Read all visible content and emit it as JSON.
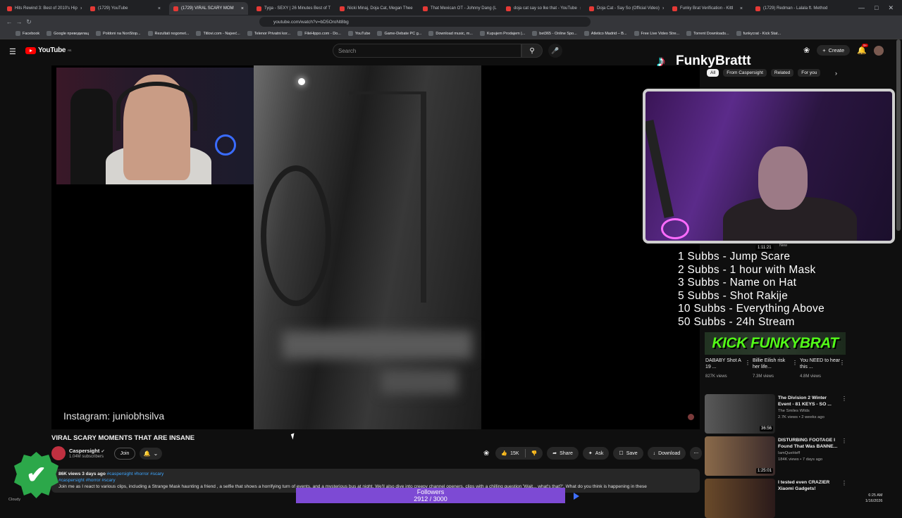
{
  "tabs": [
    {
      "label": "Hits Rewind 3: Best of 2010's Hip",
      "active": false
    },
    {
      "label": "(1729) YouTube",
      "active": false
    },
    {
      "label": "(1729) VIRAL SCARY MOM",
      "active": true
    },
    {
      "label": "Tyga - SEXY | 26 Minutes Best of T",
      "active": false
    },
    {
      "label": "Nicki Minaj, Doja Cat, Megan Thee",
      "active": false
    },
    {
      "label": "That Mexican OT - Johnny Dang (L",
      "active": false
    },
    {
      "label": "doja cat say so lke that - YouTube",
      "active": false
    },
    {
      "label": "Doja Cat - Say So (Official Video)",
      "active": false
    },
    {
      "label": "Funky Brat Verification - Kittl",
      "active": false
    },
    {
      "label": "(1729) Redman - Lalala ft. Method",
      "active": false
    }
  ],
  "url": "youtube.com/watch?v=bD5OroNt8bg",
  "bookmarks": [
    "Facebook",
    "Google преводилац",
    "Poldoni na NonStop...",
    "Rezultati nogomet...",
    "Titlovi.com - Najveć...",
    "Telenor Privatni kor...",
    "FileHippo.com - Do...",
    "YouTube",
    "Game-Debate PC g...",
    "Download music, m...",
    "Kupujem Prodajem |...",
    "bet365 - Online Spo...",
    "Atletico Madrid – B...",
    "Free Live Video Stre...",
    "Torrent Downloads...",
    "funkycrat - Kick Stat..."
  ],
  "youtube": {
    "logo": "YouTube",
    "logo_sup": "RS",
    "search_placeholder": "Search",
    "create_label": "Create",
    "notif_count": "9+",
    "chips": [
      "All",
      "From Caspersight",
      "Related",
      "For you"
    ]
  },
  "video": {
    "instagram_overlay": "Instagram: juniobhsilva",
    "title": "VIRAL SCARY MOMENTS THAT ARE INSANE",
    "channel": "Caspersight",
    "subscribers": "1.04M subscribers",
    "join_label": "Join",
    "likes": "15K",
    "share_label": "Share",
    "ask_label": "Ask",
    "save_label": "Save",
    "download_label": "Download",
    "description_meta": "86K views  3 days ago",
    "description_tags": "#caspersight #horror #scary",
    "description_tags2": "#caspersight #horror #scary",
    "description_text": "Join me as I react to various clips, including a Strange Mask haunting a friend , a selfie that shows a horrifying turn of events, and a mysterious bus at night. We'll also dive into creepy channel openers, clips with a chilling question 'Wait... what's that?'. What do you think is happening in these"
  },
  "overlay": {
    "brand_name": "FunkyBrattt",
    "cam2_time": "1:11:21",
    "cam2_badge": "New",
    "subs_goals": [
      "1 Subbs - Jump Scare",
      "2 Subbs - 1 hour with Mask",
      "3 Subbs - Name on Hat",
      "5 Subbs - Shot Rakije",
      "10 Subbs - Everything Above",
      "50 Subbs - 24h Stream"
    ],
    "kick_banner": "KICK FUNKYBRAT",
    "followers_label": "Followers",
    "followers_count": "2912 / 3000",
    "followers_progress": 0.971
  },
  "shorts": [
    {
      "title": "DABABY Shot A 19 ...",
      "views": "827K views"
    },
    {
      "title": "Billie Eilish risk her life...",
      "views": "7.3M views"
    },
    {
      "title": "You NEED to hear this ...",
      "views": "4.8M views"
    }
  ],
  "recommendations": [
    {
      "title": "The Division 2 Winter Event - 81 KEYS - SO ...",
      "channel": "The Smiles Wilds",
      "meta": "2.7K views • 2 weeks ago",
      "duration": "36:56"
    },
    {
      "title": "DISTURBING FOOTAGE I Found That Was BANNE...",
      "channel": "IamQueHeff",
      "meta": "184K views • 7 days ago",
      "duration": "1:25:01"
    },
    {
      "title": "I tested even CRAZIER Xiaomi Gadgets!",
      "channel": "",
      "meta": "",
      "duration": ""
    }
  ],
  "system": {
    "time": "6:25 AM",
    "date": "1/16/2026",
    "weather": "Cloudy"
  }
}
